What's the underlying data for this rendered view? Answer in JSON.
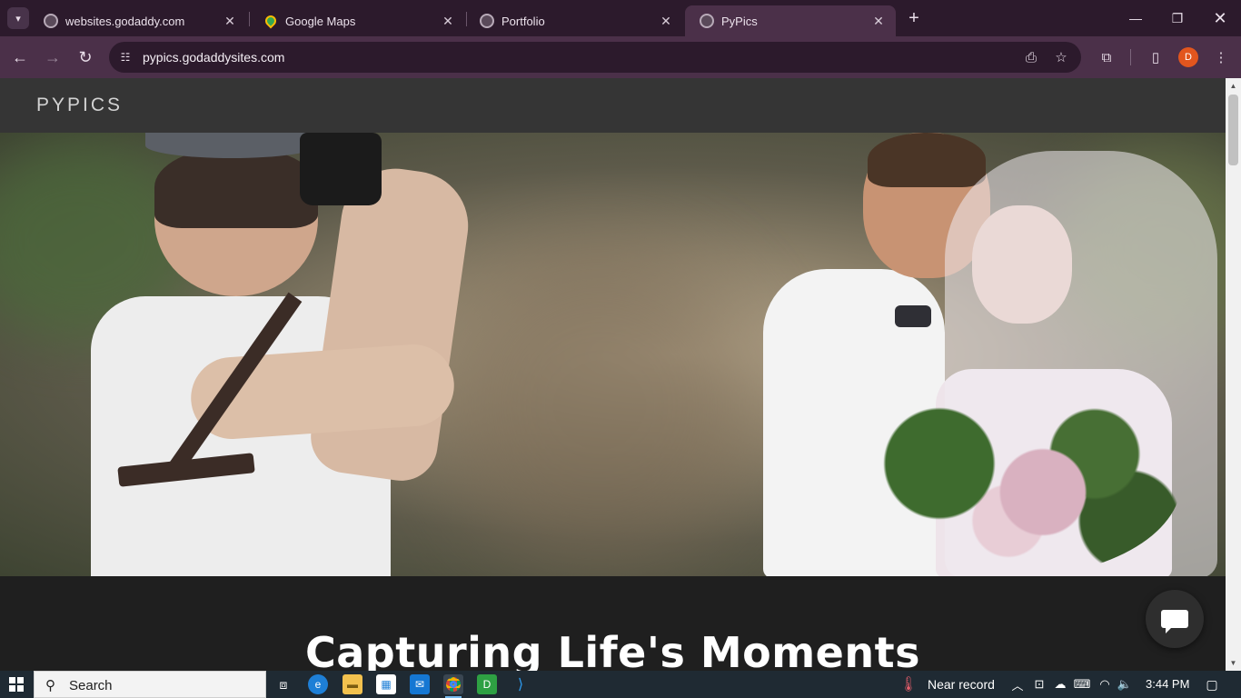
{
  "browser": {
    "tabs": [
      {
        "title": "websites.godaddy.com",
        "favicon": "globe-icon"
      },
      {
        "title": "Google Maps",
        "favicon": "google-maps-icon"
      },
      {
        "title": "Portfolio",
        "favicon": "globe-icon"
      },
      {
        "title": "PyPics",
        "favicon": "globe-icon",
        "active": true
      }
    ],
    "url": "pypics.godaddysites.com",
    "profile_initial": "D",
    "accent": "#4b3049"
  },
  "site": {
    "brand": "PYPICS",
    "hero_heading": "Capturing Life's Moments"
  },
  "taskbar": {
    "search_label": "Search",
    "weather": "Near record",
    "time": "3:44 PM"
  }
}
